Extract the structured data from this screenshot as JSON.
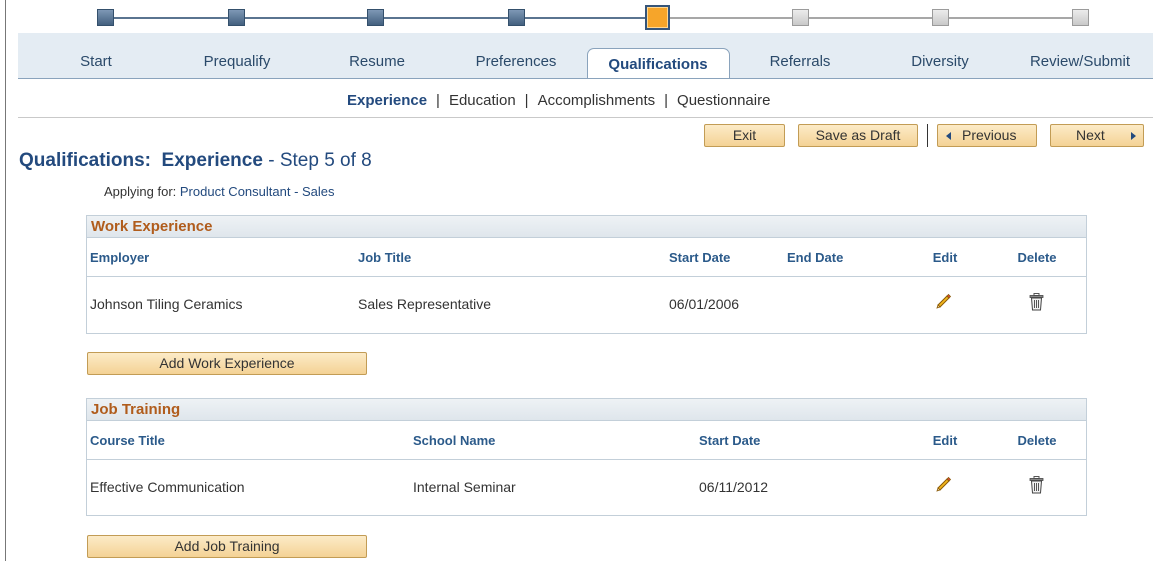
{
  "train": {
    "steps": [
      {
        "label": "Start",
        "state": "done"
      },
      {
        "label": "Prequalify",
        "state": "done"
      },
      {
        "label": "Resume",
        "state": "done"
      },
      {
        "label": "Preferences",
        "state": "done"
      },
      {
        "label": "Qualifications",
        "state": "current"
      },
      {
        "label": "Referrals",
        "state": "todo"
      },
      {
        "label": "Diversity",
        "state": "todo"
      },
      {
        "label": "Review/Submit",
        "state": "todo"
      }
    ],
    "colors": {
      "done": "#4d6a8a",
      "current": "#f6a52a",
      "todo": "#d4d4d4"
    }
  },
  "subnav": {
    "items": [
      "Experience",
      "Education",
      "Accomplishments",
      "Questionnaire"
    ],
    "separator": "|",
    "active": "Experience"
  },
  "toolbar": {
    "exit_label": "Exit",
    "save_draft_label": "Save as Draft",
    "previous_label": "Previous",
    "next_label": "Next"
  },
  "heading": {
    "section": "Qualifications:",
    "subsection": "Experience",
    "step": "- Step 5 of 8",
    "applying_label": "Applying for:",
    "applying_job": "Product Consultant - Sales"
  },
  "work_experience": {
    "title": "Work Experience",
    "columns": [
      "Employer",
      "Job Title",
      "Start Date",
      "End Date",
      "Edit",
      "Delete"
    ],
    "rows": [
      {
        "employer": "Johnson Tiling Ceramics",
        "job_title": "Sales Representative",
        "start_date": "06/01/2006",
        "end_date": ""
      }
    ],
    "add_label": "Add Work Experience"
  },
  "job_training": {
    "title": "Job Training",
    "columns": [
      "Course Title",
      "School Name",
      "Start Date",
      "Edit",
      "Delete"
    ],
    "rows": [
      {
        "course_title": "Effective Communication",
        "school_name": "Internal Seminar",
        "start_date": "06/11/2012"
      }
    ],
    "add_label": "Add Job Training"
  },
  "icons": {
    "edit": "pencil-icon",
    "delete": "trash-icon",
    "previous": "triangle-left-icon",
    "next": "triangle-right-icon"
  },
  "colors": {
    "link": "#234a7e",
    "grid_title": "#b05c1c",
    "button_bg": "#f6d89c"
  }
}
